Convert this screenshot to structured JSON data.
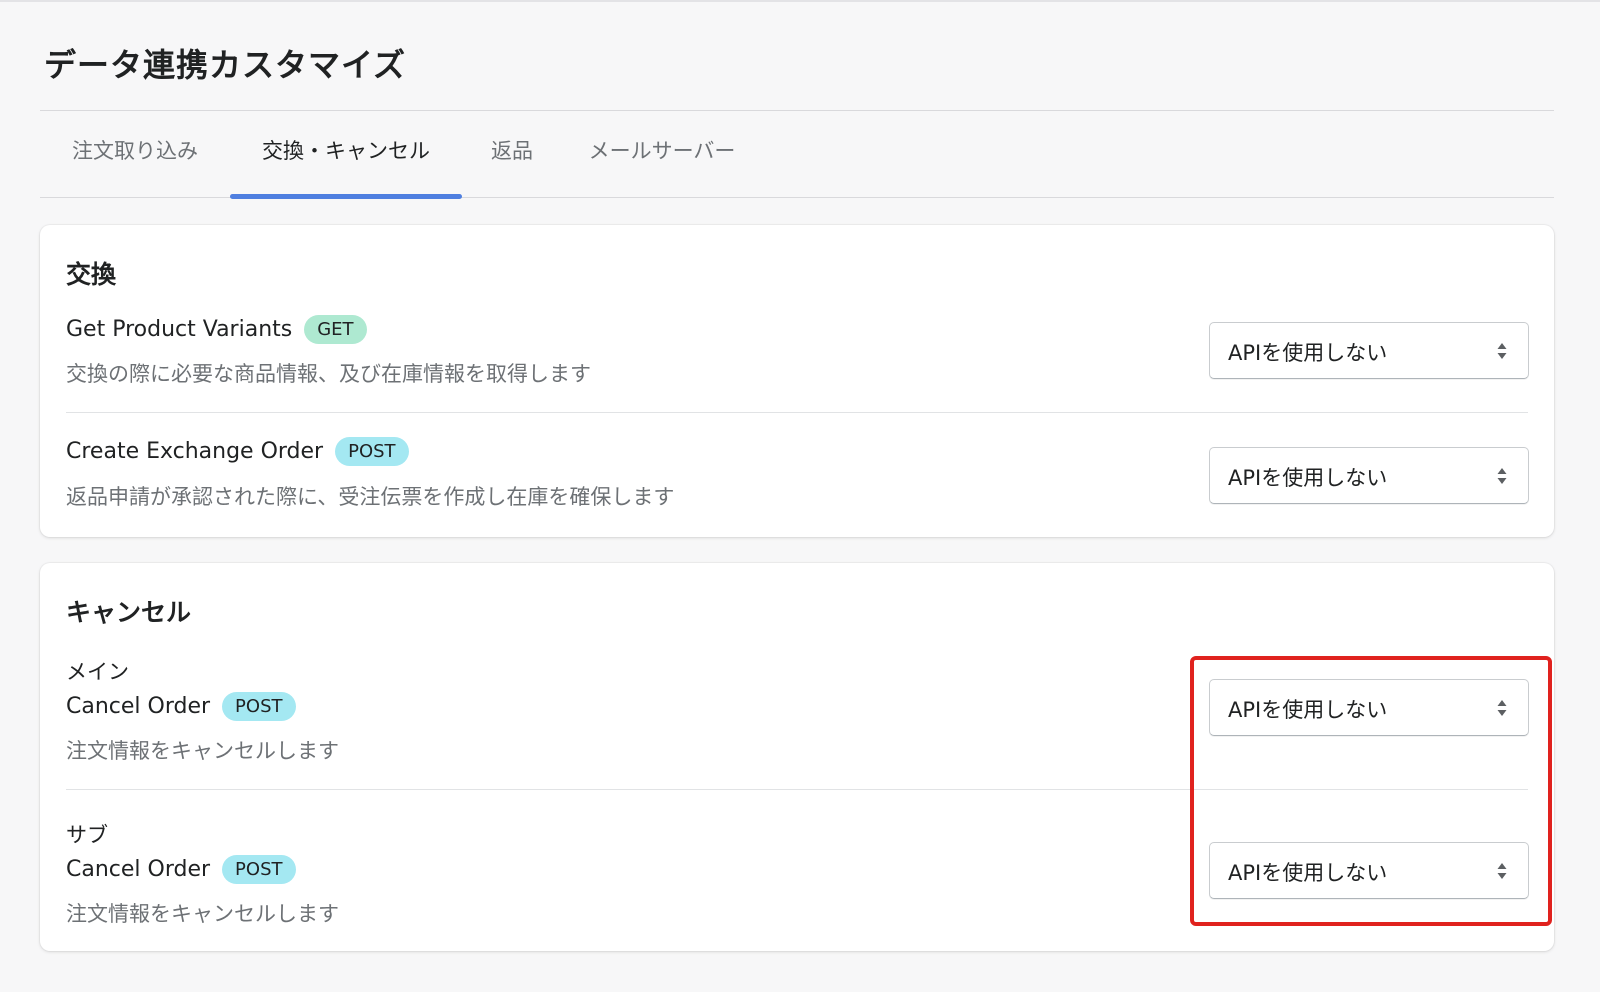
{
  "page": {
    "title": "データ連携カスタマイズ"
  },
  "tabs": [
    {
      "label": "注文取り込み",
      "active": false
    },
    {
      "label": "交換・キャンセル",
      "active": true
    },
    {
      "label": "返品",
      "active": false
    },
    {
      "label": "メールサーバー",
      "active": false
    }
  ],
  "exchange": {
    "title": "交換",
    "rows": [
      {
        "name": "Get Product Variants",
        "method": "GET",
        "description": "交換の際に必要な商品情報、及び在庫情報を取得します",
        "select_value": "APIを使用しない"
      },
      {
        "name": "Create Exchange Order",
        "method": "POST",
        "description": "返品申請が承認された際に、受注伝票を作成し在庫を確保します",
        "select_value": "APIを使用しない"
      }
    ]
  },
  "cancel": {
    "title": "キャンセル",
    "rows": [
      {
        "label": "メイン",
        "name": "Cancel Order",
        "method": "POST",
        "description": "注文情報をキャンセルします",
        "select_value": "APIを使用しない"
      },
      {
        "label": "サブ",
        "name": "Cancel Order",
        "method": "POST",
        "description": "注文情報をキャンセルします",
        "select_value": "APIを使用しない"
      }
    ]
  },
  "colors": {
    "active_tab_indicator": "#4f7fe0",
    "get_badge": "#aee9d1",
    "post_badge": "#a4e8f2",
    "highlight_box": "#e0221e"
  }
}
